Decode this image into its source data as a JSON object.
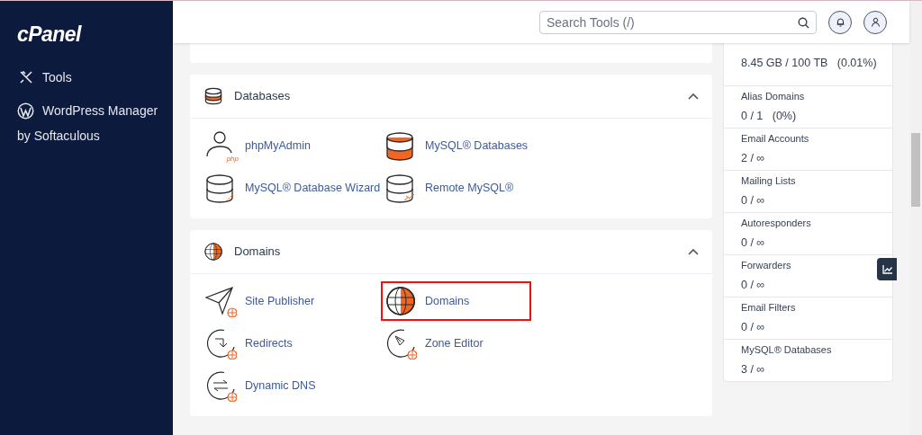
{
  "sidebar": {
    "logo": "cPanel",
    "items": [
      {
        "label": "Tools"
      },
      {
        "label": "WordPress Manager",
        "sublabel": "by Softaculous"
      }
    ]
  },
  "header": {
    "search": {
      "placeholder": "Search Tools (/)"
    }
  },
  "sections": [
    {
      "title": "Databases",
      "expanded": true,
      "items": [
        {
          "label": "phpMyAdmin",
          "icon_text": "php",
          "highlighted": false
        },
        {
          "label": "MySQL® Databases",
          "highlighted": false
        },
        {
          "label": "MySQL® Database Wizard",
          "highlighted": false
        },
        {
          "label": "Remote MySQL®",
          "highlighted": false
        }
      ]
    },
    {
      "title": "Domains",
      "expanded": true,
      "items": [
        {
          "label": "Site Publisher",
          "highlighted": false
        },
        {
          "label": "Domains",
          "highlighted": true
        },
        {
          "label": "Redirects",
          "highlighted": false
        },
        {
          "label": "Zone Editor",
          "highlighted": false
        },
        {
          "label": "Dynamic DNS",
          "highlighted": false
        }
      ]
    }
  ],
  "stats": [
    {
      "value": "8.45 GB / 100 TB   (0.01%)"
    },
    {
      "label": "Alias Domains",
      "value": "0 / 1   (0%)"
    },
    {
      "label": "Email Accounts",
      "value": "2 / ∞"
    },
    {
      "label": "Mailing Lists",
      "value": "0 / ∞"
    },
    {
      "label": "Autoresponders",
      "value": "0 / ∞"
    },
    {
      "label": "Forwarders",
      "value": "0 / ∞"
    },
    {
      "label": "Email Filters",
      "value": "0 / ∞"
    },
    {
      "label": "MySQL® Databases",
      "value": "3 / ∞"
    }
  ]
}
